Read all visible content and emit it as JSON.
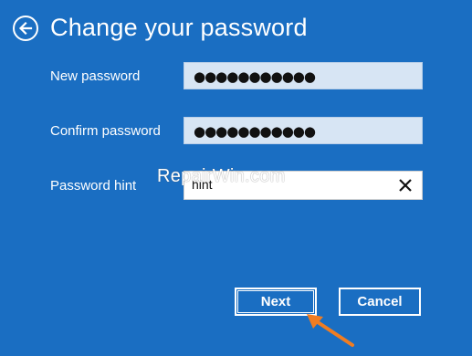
{
  "header": {
    "title": "Change your password",
    "back_icon": "back-arrow-icon"
  },
  "form": {
    "new_password": {
      "label": "New password",
      "value": "●●●●●●●●●●●"
    },
    "confirm_password": {
      "label": "Confirm password",
      "value": "●●●●●●●●●●●"
    },
    "password_hint": {
      "label": "Password hint",
      "value": "hint",
      "clear_icon": "close-icon"
    }
  },
  "watermark": "RepairWin.com",
  "buttons": {
    "next": "Next",
    "cancel": "Cancel"
  },
  "colors": {
    "background": "#1a6ec2",
    "field_bg": "#d7e5f4",
    "arrow": "#f07d22"
  }
}
